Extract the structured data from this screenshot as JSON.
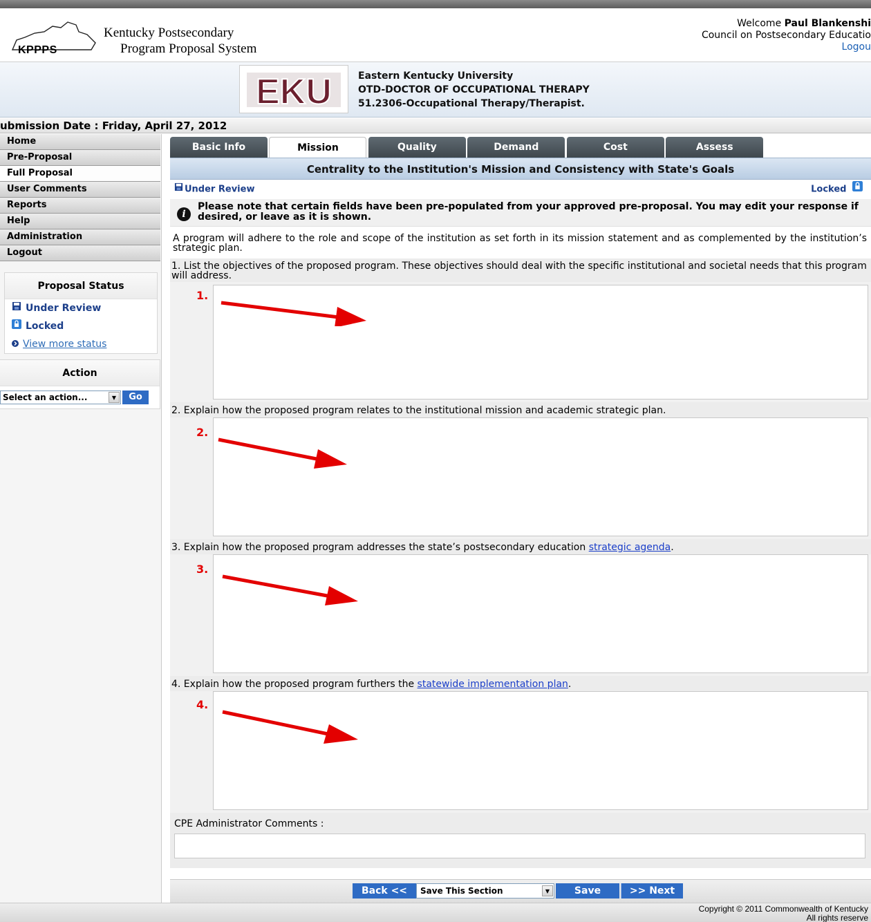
{
  "header": {
    "logo_text": "KPPPS",
    "system_title_line1": "Kentucky Postsecondary",
    "system_title_line2": "Program Proposal System",
    "welcome_prefix": "Welcome",
    "user_name": "Paul Blankenshi",
    "organization": "Council on Postsecondary Educatio",
    "logout_link": "Logou"
  },
  "institution": {
    "logo_text": "EKU",
    "name": "Eastern Kentucky University",
    "program": "OTD-DOCTOR OF OCCUPATIONAL THERAPY",
    "cip": "51.2306-Occupational Therapy/Therapist."
  },
  "submission_date": "ubmission Date : Friday, April 27, 2012",
  "sidebar": {
    "nav": [
      {
        "label": "Home",
        "active": false
      },
      {
        "label": "Pre-Proposal",
        "active": false
      },
      {
        "label": "Full Proposal",
        "active": true
      },
      {
        "label": "User Comments",
        "active": false
      },
      {
        "label": "Reports",
        "active": false
      },
      {
        "label": "Help",
        "active": false
      },
      {
        "label": "Administration",
        "active": false
      },
      {
        "label": "Logout",
        "active": false
      }
    ],
    "proposal_status": {
      "title": "Proposal Status",
      "under_review": "Under Review",
      "locked": "Locked",
      "view_more": "View more status"
    },
    "action": {
      "title": "Action",
      "select_value": "Select an action...",
      "go_label": "Go"
    }
  },
  "main": {
    "tabs": [
      {
        "label": "Basic Info",
        "active": false
      },
      {
        "label": "Mission",
        "active": true
      },
      {
        "label": "Quality",
        "active": false
      },
      {
        "label": "Demand",
        "active": false
      },
      {
        "label": "Cost",
        "active": false
      },
      {
        "label": "Assess",
        "active": false
      }
    ],
    "section_title": "Centrality to the Institution's Mission and Consistency with State's Goals",
    "status_left": "Under Review",
    "status_right": "Locked",
    "note": "Please note that certain fields have been pre-populated from your approved pre-proposal. You may edit your response if desired, or leave as it is shown.",
    "intro": "A program will adhere to the role and scope of the institution as set forth in its mission statement and as complemented by the institution’s strategic plan.",
    "questions": [
      {
        "text": "1. List the objectives of the proposed program. These objectives should deal with the specific institutional and societal needs that this program will address.",
        "marker": "1."
      },
      {
        "text": "2. Explain how the proposed program relates to the institutional mission and academic strategic plan.",
        "marker": "2."
      },
      {
        "text_before": "3. Explain how the proposed program addresses the state’s postsecondary education ",
        "link": "strategic agenda",
        "text_after": ".",
        "marker": "3."
      },
      {
        "text_before": "4. Explain how the proposed program furthers the ",
        "link": "statewide implementation plan",
        "text_after": ".",
        "marker": "4."
      }
    ],
    "comments_label": "CPE Administrator Comments :",
    "bottom": {
      "back_label": "Back <<",
      "save_select_value": "Save This Section",
      "save_label": "Save",
      "next_label": ">> Next"
    }
  },
  "footer": {
    "line1": "Copyright © 2011 Commonwealth of Kentucky",
    "line2": "All rights reserve"
  },
  "colors": {
    "button_blue": "#2e6bc4",
    "annotation_red": "#e30000",
    "status_blue": "#1c3f8a",
    "eku_maroon": "#6b1f2e"
  }
}
